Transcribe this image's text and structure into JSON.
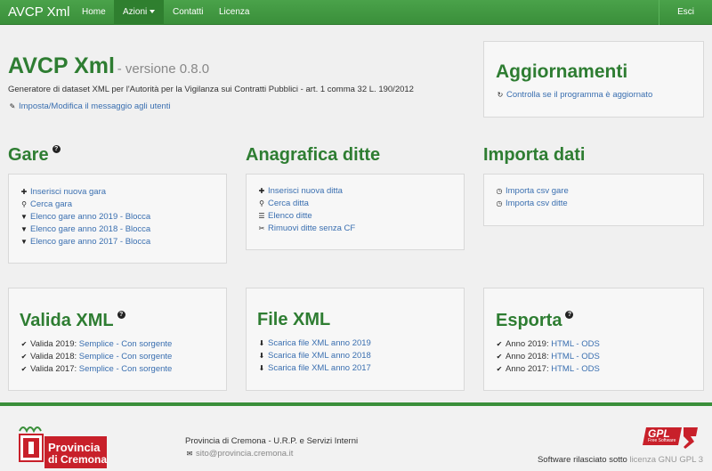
{
  "navbar": {
    "brand": "AVCP Xml",
    "items": [
      "Home",
      "Azioni",
      "Contatti",
      "Licenza"
    ],
    "right": "Esci"
  },
  "hero": {
    "title": "AVCP Xml",
    "version": "- versione 0.8.0",
    "subtitle": "Generatore di dataset XML per l'Autorità per la Vigilanza sui Contratti Pubblici - art. 1 comma 32 L. 190/2012",
    "edit_link": "Imposta/Modifica il messaggio agli utenti"
  },
  "updates": {
    "title": "Aggiornamenti",
    "link": "Controlla se il programma è aggiornato"
  },
  "gare": {
    "title": "Gare",
    "items": [
      "Inserisci nuova gara",
      "Cerca gara",
      "Elenco gare anno 2019 - Blocca",
      "Elenco gare anno 2018 - Blocca",
      "Elenco gare anno 2017 - Blocca"
    ]
  },
  "anagrafica": {
    "title": "Anagrafica ditte",
    "items": [
      "Inserisci nuova ditta",
      "Cerca ditta",
      "Elenco ditte",
      "Rimuovi ditte senza CF"
    ]
  },
  "importa": {
    "title": "Importa dati",
    "items": [
      "Importa csv gare",
      "Importa csv ditte"
    ]
  },
  "valida": {
    "title": "Valida XML",
    "rows": [
      {
        "label": "Valida 2019: ",
        "link": "Semplice - Con sorgente"
      },
      {
        "label": "Valida 2018: ",
        "link": "Semplice - Con sorgente"
      },
      {
        "label": "Valida 2017: ",
        "link": "Semplice - Con sorgente"
      }
    ]
  },
  "filexml": {
    "title": "File XML",
    "items": [
      "Scarica file XML anno 2019",
      "Scarica file XML anno 2018",
      "Scarica file XML anno 2017"
    ]
  },
  "esporta": {
    "title": "Esporta",
    "rows": [
      {
        "label": "Anno 2019: ",
        "link": "HTML - ODS"
      },
      {
        "label": "Anno 2018: ",
        "link": "HTML - ODS"
      },
      {
        "label": "Anno 2017: ",
        "link": "HTML - ODS"
      }
    ]
  },
  "footer": {
    "logo_line1": "Provincia",
    "logo_line2": "di Cremona",
    "org": "Provincia di Cremona - U.R.P. e Servizi Interni",
    "email": "sito@provincia.cremona.it",
    "gpl_text": "GPL",
    "gpl_small": "Free Software",
    "license_prefix": "Software rilasciato sotto ",
    "license_link": "licenza GNU GPL 3"
  },
  "colors": {
    "navbar": "#3a8f3a",
    "heading": "#2e7d32",
    "link": "#3a6fb0",
    "logo_red": "#c8202a"
  }
}
